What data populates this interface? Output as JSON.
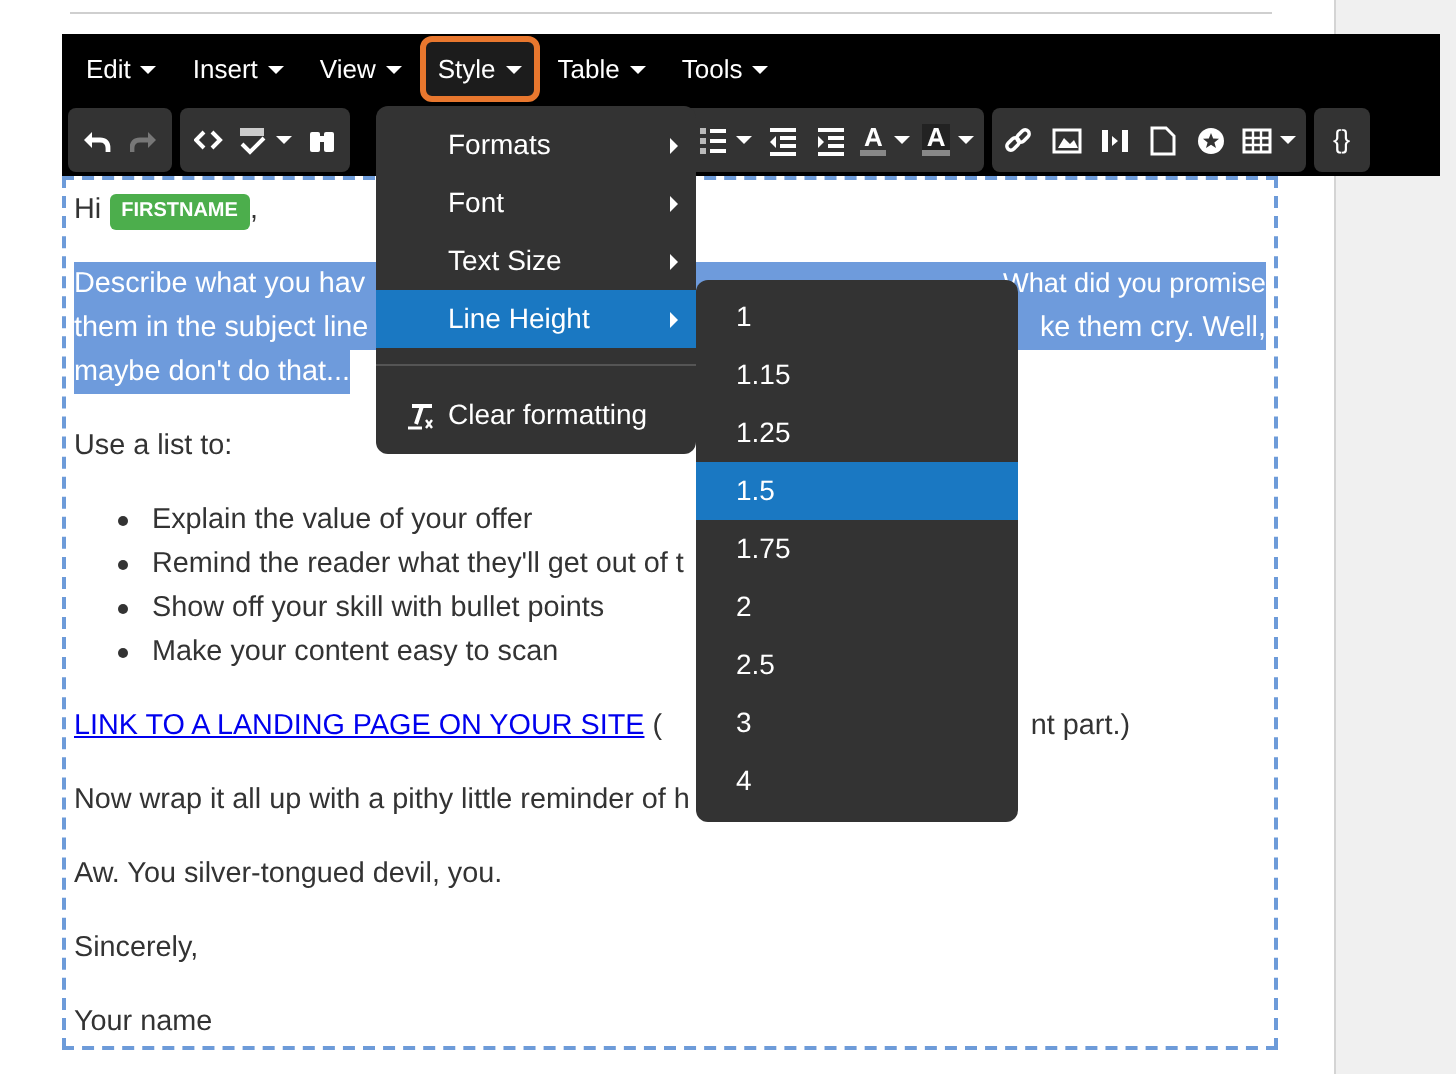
{
  "menubar": [
    {
      "label": "Edit",
      "selected": false
    },
    {
      "label": "Insert",
      "selected": false
    },
    {
      "label": "View",
      "selected": false
    },
    {
      "label": "Style",
      "selected": true
    },
    {
      "label": "Table",
      "selected": false
    },
    {
      "label": "Tools",
      "selected": false
    }
  ],
  "toolbar": {
    "text_color_label": "A",
    "background_color_label": "A",
    "source_code_label": "{}"
  },
  "content": {
    "greeting": {
      "text": "Hi",
      "merge_tag": "FIRSTNAME",
      "after": ","
    },
    "intro": {
      "highlighted": true,
      "lines": [
        {
          "left": "Describe what you hav",
          "right": "What did you promise"
        },
        {
          "left": "them in the subject line",
          "right": "ke them cry. Well,"
        },
        {
          "left": "maybe don't do that..."
        }
      ]
    },
    "list_intro": "Use a list to:",
    "bullets": [
      "Explain the value of your offer",
      "Remind the reader what they'll get out of t",
      "Show off your skill with bullet points",
      "Make your content easy to scan"
    ],
    "link": {
      "text": "LINK TO A LANDING PAGE ON YOUR SITE",
      "after": "(",
      "tail": "nt part.)"
    },
    "paragraphs": [
      "Now wrap it all up with a pithy little reminder of h",
      "Aw. You silver-tongued devil, you.",
      "Sincerely,",
      "Your name"
    ]
  },
  "style_menu": [
    {
      "label": "Formats",
      "kind": "submenu",
      "selected": false
    },
    {
      "label": "Font",
      "kind": "submenu",
      "selected": false
    },
    {
      "label": "Text Size",
      "kind": "submenu",
      "selected": false
    },
    {
      "label": "Line Height",
      "kind": "submenu",
      "selected": true
    },
    {
      "kind": "separator"
    },
    {
      "label": "Clear formatting",
      "kind": "action",
      "selected": false
    }
  ],
  "line_height_menu": [
    {
      "label": "1",
      "selected": false
    },
    {
      "label": "1.15",
      "selected": false
    },
    {
      "label": "1.25",
      "selected": false
    },
    {
      "label": "1.5",
      "selected": true
    },
    {
      "label": "1.75",
      "selected": false
    },
    {
      "label": "2",
      "selected": false
    },
    {
      "label": "2.5",
      "selected": false
    },
    {
      "label": "3",
      "selected": false
    },
    {
      "label": "4",
      "selected": false
    }
  ]
}
